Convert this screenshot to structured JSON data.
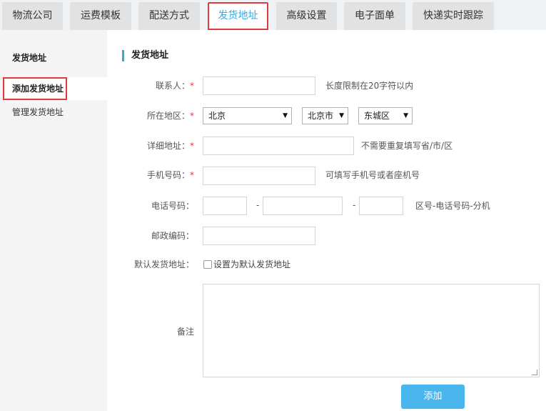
{
  "tabs": [
    {
      "label": "物流公司"
    },
    {
      "label": "运费模板"
    },
    {
      "label": "配送方式"
    },
    {
      "label": "发货地址"
    },
    {
      "label": "高级设置"
    },
    {
      "label": "电子面单"
    },
    {
      "label": "快递实时跟踪"
    }
  ],
  "sidebar": {
    "heading": "发货地址",
    "items": [
      {
        "label": "添加发货地址"
      },
      {
        "label": "管理发货地址"
      }
    ]
  },
  "form": {
    "title": "发货地址",
    "required_mark": "*",
    "contact": {
      "label": "联系人：",
      "hint": "长度限制在20字符以内"
    },
    "region": {
      "label": "所在地区：",
      "province": "北京",
      "city": "北京市",
      "district": "东城区"
    },
    "address": {
      "label": "详细地址：",
      "hint": "不需要重复填写省/市/区"
    },
    "mobile": {
      "label": "手机号码：",
      "hint": "可填写手机号或者座机号"
    },
    "phone": {
      "label": "电话号码：",
      "separator": "-",
      "hint": "区号-电话号码-分机"
    },
    "postcode": {
      "label": "邮政编码："
    },
    "default": {
      "label": "默认发货地址：",
      "checkbox_label": "设置为默认发货地址",
      "checked": false
    },
    "note": {
      "label": "备注"
    },
    "submit_label": "添加"
  },
  "colors": {
    "accent": "#3ba8e0",
    "button": "#4ab6ee",
    "highlight": "#e0393e",
    "required": "#e0393e"
  }
}
